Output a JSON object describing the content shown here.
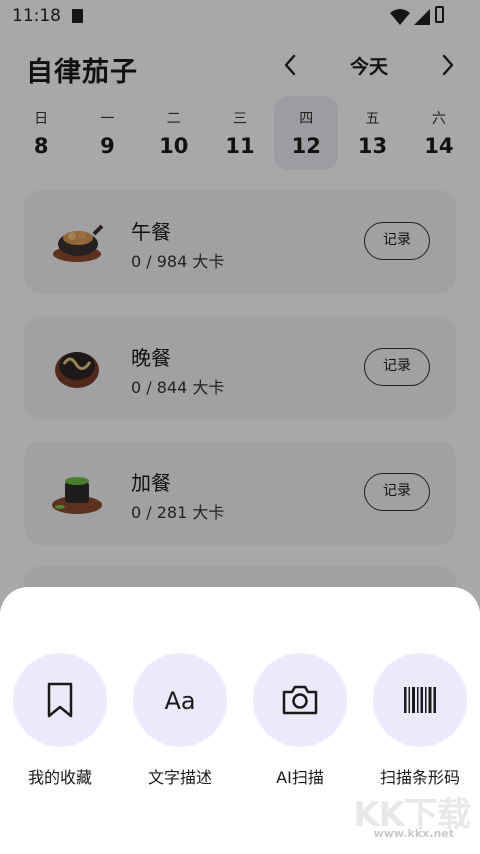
{
  "status_bar": {
    "time": "11:18"
  },
  "header": {
    "app_name": "自律茄子",
    "date_label": "今天"
  },
  "week": [
    {
      "weekday": "日",
      "date": "8",
      "selected": false
    },
    {
      "weekday": "一",
      "date": "9",
      "selected": false
    },
    {
      "weekday": "二",
      "date": "10",
      "selected": false
    },
    {
      "weekday": "三",
      "date": "11",
      "selected": false
    },
    {
      "weekday": "四",
      "date": "12",
      "selected": true
    },
    {
      "weekday": "五",
      "date": "13",
      "selected": false
    },
    {
      "weekday": "六",
      "date": "14",
      "selected": false
    }
  ],
  "meals": [
    {
      "name": "午餐",
      "calories": "0 / 984 大卡",
      "record_label": "记录",
      "icon": "lunch-dish-icon"
    },
    {
      "name": "晚餐",
      "calories": "0 / 844 大卡",
      "record_label": "记录",
      "icon": "dinner-dish-icon"
    },
    {
      "name": "加餐",
      "calories": "0 / 281 大卡",
      "record_label": "记录",
      "icon": "snack-dish-icon"
    }
  ],
  "sheet": {
    "actions": [
      {
        "label": "我的收藏",
        "icon": "bookmark-icon"
      },
      {
        "label": "文字描述",
        "icon": "text-aa-icon"
      },
      {
        "label": "AI扫描",
        "icon": "camera-icon"
      },
      {
        "label": "扫描条形码",
        "icon": "barcode-icon"
      }
    ]
  },
  "watermark": {
    "brand": "KK下载",
    "url": "www.kkx.net"
  },
  "colors": {
    "sheet_bg": "#ffffff",
    "action_circle": "#ebe9fb",
    "card_bg": "#f1eff4",
    "scrim": "rgba(0,0,0,0.33)"
  }
}
